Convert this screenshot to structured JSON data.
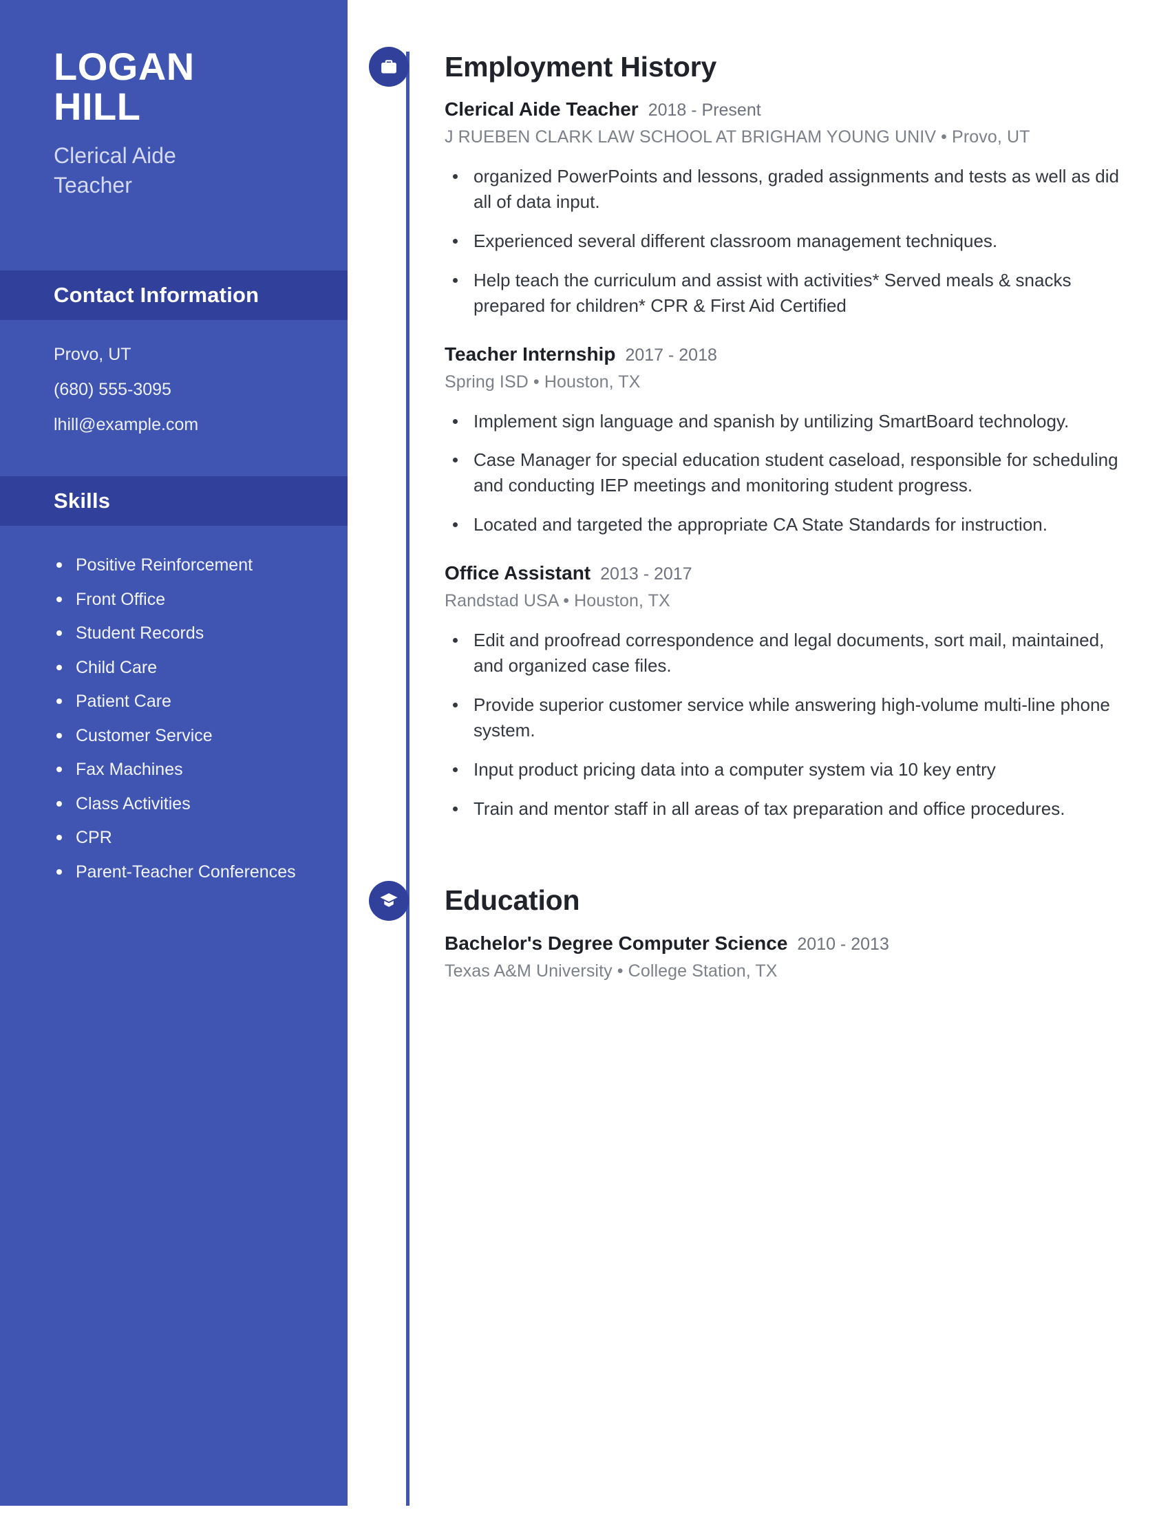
{
  "theme": {
    "sidebar_bg": "#4054b2",
    "band_bg": "#31409a",
    "accent": "#31409a",
    "page_bg": "#ffffff",
    "body_text": "#33373f",
    "muted_text": "#7b8089"
  },
  "sidebar": {
    "name_lines": [
      "LOGAN",
      "HILL"
    ],
    "job_title_lines": [
      "Clerical Aide",
      "Teacher"
    ],
    "contact": {
      "heading": "Contact Information",
      "items": [
        "Provo, UT",
        "(680) 555-3095",
        "lhill@example.com"
      ]
    },
    "skills": {
      "heading": "Skills",
      "items": [
        "Positive Reinforcement",
        "Front Office",
        "Student Records",
        "Child Care",
        "Patient Care",
        "Customer Service",
        "Fax Machines",
        "Class Activities",
        "CPR",
        "Parent-Teacher Conferences"
      ]
    }
  },
  "main": {
    "employment": {
      "heading": "Employment History",
      "icon": "briefcase-icon",
      "entries": [
        {
          "title": "Clerical Aide Teacher",
          "dates": "2018 - Present",
          "subtitle": "J RUEBEN CLARK LAW SCHOOL AT BRIGHAM YOUNG UNIV  •  Provo, UT",
          "bullets": [
            "organized PowerPoints and lessons, graded assignments and tests as well as did all of data input.",
            "Experienced several different classroom management techniques.",
            "Help teach the curriculum and assist with activities* Served meals & snacks prepared for children* CPR & First Aid Certified"
          ]
        },
        {
          "title": "Teacher Internship",
          "dates": "2017 - 2018",
          "subtitle": "Spring ISD  •  Houston, TX",
          "bullets": [
            "Implement sign language and spanish by untilizing SmartBoard technology.",
            "Case Manager for special education student caseload, responsible for scheduling and conducting IEP meetings and monitoring student progress.",
            "Located and targeted the appropriate CA State Standards for instruction."
          ]
        },
        {
          "title": "Office Assistant",
          "dates": "2013 - 2017",
          "subtitle": "Randstad USA  •  Houston, TX",
          "bullets": [
            "Edit and proofread correspondence and legal documents, sort mail, maintained, and organized case files.",
            "Provide superior customer service while answering high-volume multi-line phone system.",
            "Input product pricing data into a computer system via 10 key entry",
            "Train and mentor staff in all areas of tax preparation and office procedures."
          ]
        }
      ]
    },
    "education": {
      "heading": "Education",
      "icon": "graduation-cap-icon",
      "entries": [
        {
          "title": "Bachelor's Degree Computer Science",
          "dates": "2010 - 2013",
          "subtitle": "Texas A&M University  •  College Station, TX",
          "bullets": []
        }
      ]
    }
  }
}
